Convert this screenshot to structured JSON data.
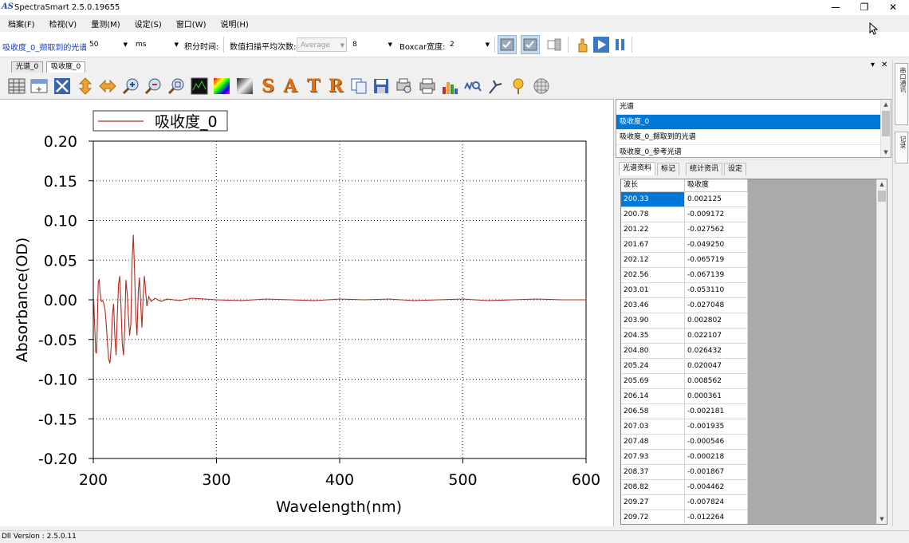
{
  "app": {
    "title": "SpectraSmart 2.5.0.19655",
    "logo": "AS",
    "window_buttons": [
      "—",
      "❐",
      "✕"
    ]
  },
  "menu": [
    "档案(F)",
    "检视(V)",
    "量测(M)",
    "设定(S)",
    "窗口(W)",
    "说明(H)"
  ],
  "params": {
    "spectrum_name": "吸收度_0_撷取到的光谱",
    "integration_value": "50",
    "integration_unit": "ms",
    "integration_label": "积分时间:",
    "avg_label": "数值扫描平均次数:",
    "avg_mode": "Average",
    "avg_count": "8",
    "boxcar_label": "Boxcar宽度:",
    "boxcar_value": "2"
  },
  "doc_tabs": [
    "光谱_0",
    "吸收度_0"
  ],
  "doc_controls": [
    "▾",
    "✕"
  ],
  "toolbar_icons": [
    "table-icon",
    "add-row-icon",
    "fit-icon",
    "vertical-scale-icon",
    "horizontal-scale-icon",
    "zoom-in-icon",
    "zoom-out-icon",
    "zoom-box-icon",
    "dark-spectrum-icon",
    "color-spectrum-icon",
    "gray-spectrum-icon",
    "s-mode-icon",
    "a-mode-icon",
    "t-mode-icon",
    "r-mode-icon",
    "copy-icon",
    "save-icon",
    "print-preview-icon",
    "print-icon",
    "peak-icon",
    "peak-search-icon",
    "tool-icon",
    "marker-icon",
    "grid-icon"
  ],
  "mode_letters": [
    "S",
    "A",
    "T",
    "R"
  ],
  "spectrum_list": {
    "header": "光谱",
    "items": [
      "吸收度_0",
      "吸收度_0_撷取到的光谱",
      "吸收度_0_参考光谱"
    ],
    "selected_index": 0
  },
  "sub_tabs": [
    "光谱资料",
    "标记",
    "统计资讯",
    "设定"
  ],
  "table": {
    "columns": [
      "波长",
      "吸收度"
    ],
    "rows": [
      [
        "200.33",
        "0.002125"
      ],
      [
        "200.78",
        "-0.009172"
      ],
      [
        "201.22",
        "-0.027562"
      ],
      [
        "201.67",
        "-0.049250"
      ],
      [
        "202.12",
        "-0.065719"
      ],
      [
        "202.56",
        "-0.067139"
      ],
      [
        "203.01",
        "-0.053110"
      ],
      [
        "203.46",
        "-0.027048"
      ],
      [
        "203.90",
        "0.002802"
      ],
      [
        "204.35",
        "0.022107"
      ],
      [
        "204.80",
        "0.026432"
      ],
      [
        "205.24",
        "0.020047"
      ],
      [
        "205.69",
        "0.008562"
      ],
      [
        "206.14",
        "0.000361"
      ],
      [
        "206.58",
        "-0.002181"
      ],
      [
        "207.03",
        "-0.001935"
      ],
      [
        "207.48",
        "-0.000546"
      ],
      [
        "207.93",
        "-0.000218"
      ],
      [
        "208.37",
        "-0.001867"
      ],
      [
        "208.82",
        "-0.004462"
      ],
      [
        "209.27",
        "-0.007824"
      ],
      [
        "209.72",
        "-0.012264"
      ]
    ]
  },
  "right_strip": [
    "串口通讯",
    "记录"
  ],
  "status": "Dll Version : 2.5.0.11",
  "colors": {
    "series": "#b22a1e",
    "selection": "#0078d7"
  },
  "chart_data": {
    "type": "line",
    "xlabel": "Wavelength(nm)",
    "ylabel": "Absorbance(OD)",
    "xlim": [
      200,
      600
    ],
    "ylim": [
      -0.2,
      0.2
    ],
    "xticks": [
      "200",
      "300",
      "400",
      "500",
      "600"
    ],
    "yticks": [
      "0.20",
      "0.15",
      "0.10",
      "0.05",
      "0.00",
      "-0.05",
      "-0.10",
      "-0.15",
      "-0.20"
    ],
    "grid": "dotted",
    "legend_position": "top-left",
    "series": [
      {
        "name": "吸收度_0",
        "x": [
          200.3,
          201,
          202,
          202.6,
          203,
          204,
          204.8,
          205.5,
          206.5,
          207.5,
          208.5,
          209.5,
          210.5,
          211.5,
          212.5,
          213.5,
          214.5,
          215.5,
          216.5,
          217.5,
          218.5,
          219.5,
          220.5,
          221.5,
          222.5,
          223.5,
          224.5,
          225.5,
          226.5,
          227.5,
          228.5,
          229.5,
          230.5,
          231.5,
          232.5,
          233.5,
          234.5,
          235.5,
          236.5,
          237.5,
          238.5,
          239.5,
          240.5,
          241.5,
          242.5,
          243.5,
          245,
          247,
          250,
          255,
          260,
          270,
          280,
          300,
          320,
          340,
          360,
          380,
          400,
          420,
          440,
          460,
          480,
          500,
          520,
          540,
          560,
          580,
          600
        ],
        "y": [
          0.002,
          -0.027,
          -0.066,
          -0.067,
          -0.053,
          0.022,
          0.026,
          0.009,
          -0.002,
          -0.001,
          -0.004,
          -0.012,
          -0.03,
          -0.055,
          -0.075,
          -0.08,
          -0.06,
          -0.02,
          -0.005,
          -0.045,
          -0.07,
          -0.02,
          0.02,
          0.03,
          -0.01,
          -0.055,
          -0.07,
          -0.035,
          0.025,
          0.008,
          -0.02,
          -0.045,
          -0.03,
          0.05,
          0.082,
          0.035,
          -0.02,
          -0.045,
          0.01,
          0.028,
          -0.005,
          -0.035,
          0.005,
          0.03,
          0.01,
          -0.008,
          0.004,
          -0.002,
          0.002,
          -0.002,
          0.001,
          -0.001,
          0.002,
          0.0,
          -0.001,
          0.001,
          0.0,
          -0.001,
          0.001,
          0.0,
          0.001,
          -0.001,
          0.0,
          0.001,
          -0.001,
          0.0,
          0.001,
          0.0,
          0.0
        ]
      }
    ]
  }
}
